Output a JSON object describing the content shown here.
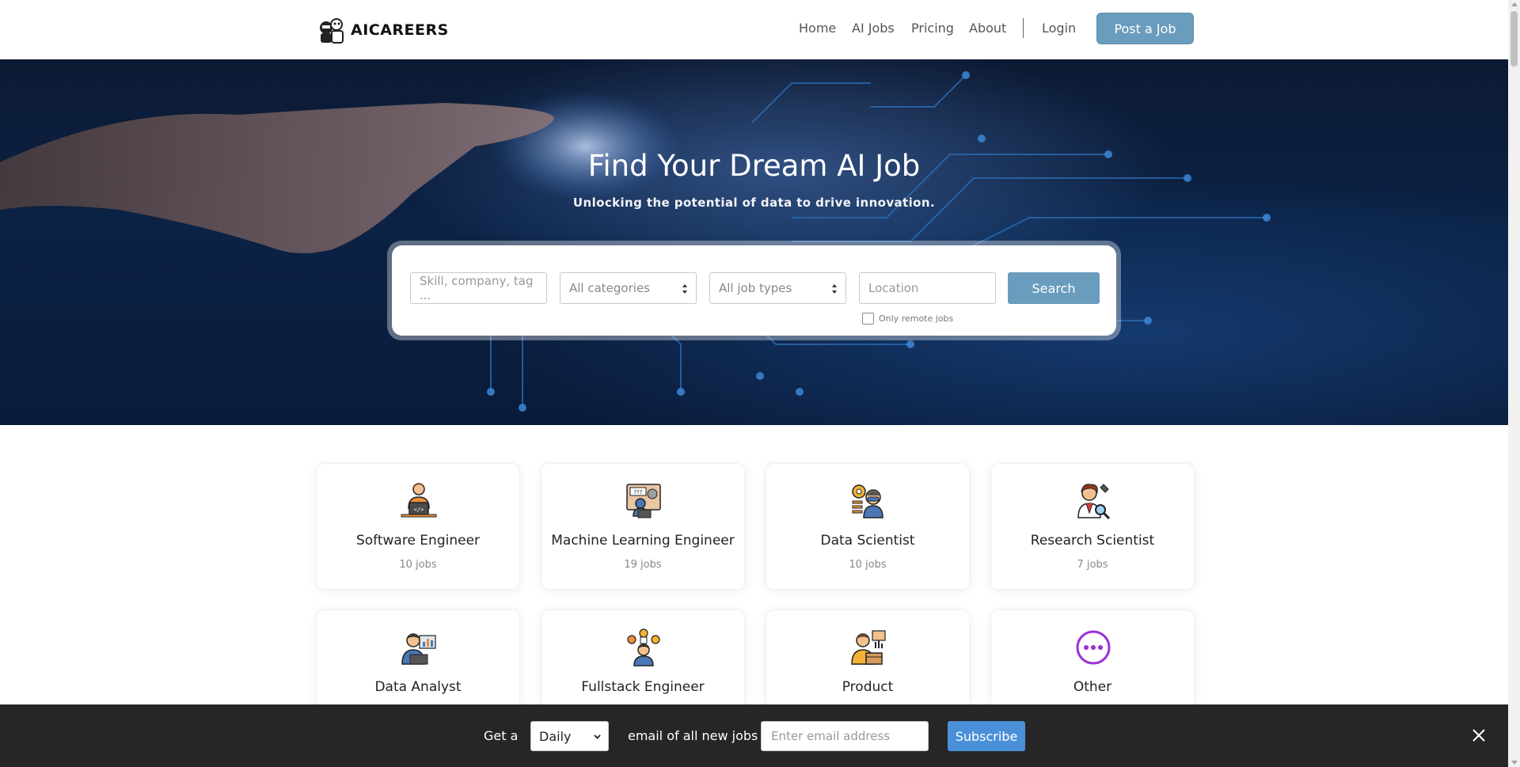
{
  "brand": {
    "name": "AICAREERS"
  },
  "nav": {
    "links": [
      "Home",
      "AI Jobs",
      "Pricing",
      "About"
    ],
    "login": "Login",
    "post_job": "Post a Job"
  },
  "hero": {
    "title": "Find Your Dream AI Job",
    "subtitle": "Unlocking the potential of data to drive innovation."
  },
  "search": {
    "keyword_placeholder": "Skill, company, tag ...",
    "category_selected": "All categories",
    "jobtype_selected": "All job types",
    "location_placeholder": "Location",
    "button": "Search",
    "remote_label": "Only remote jobs"
  },
  "categories": [
    {
      "title": "Software Engineer",
      "count": "10 jobs",
      "icon": "software-engineer-icon"
    },
    {
      "title": "Machine Learning Engineer",
      "count": "19 jobs",
      "icon": "ml-engineer-icon"
    },
    {
      "title": "Data Scientist",
      "count": "10 jobs",
      "icon": "data-scientist-icon"
    },
    {
      "title": "Research Scientist",
      "count": "7 jobs",
      "icon": "research-scientist-icon"
    },
    {
      "title": "Data Analyst",
      "count": "",
      "icon": "data-analyst-icon"
    },
    {
      "title": "Fullstack Engineer",
      "count": "",
      "icon": "fullstack-engineer-icon"
    },
    {
      "title": "Product",
      "count": "",
      "icon": "product-icon"
    },
    {
      "title": "Other",
      "count": "",
      "icon": "more-icon"
    }
  ],
  "subscribe": {
    "prefix": "Get a",
    "frequency_selected": "Daily",
    "middle": "email of all new jobs",
    "email_placeholder": "Enter email address",
    "button": "Subscribe"
  },
  "colors": {
    "accent": "#6a9cbd",
    "subscribe_button": "#4a90d9",
    "footer_bar": "#262626",
    "other_icon": "#9b2fd6"
  }
}
